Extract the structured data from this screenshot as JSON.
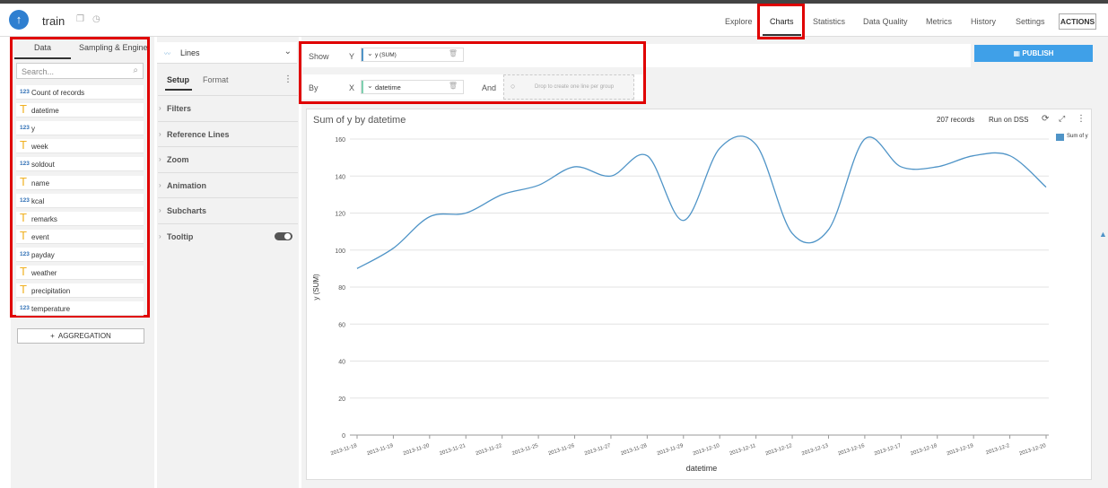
{
  "app": {
    "dataset_name": "train",
    "nav": [
      "Explore",
      "Charts",
      "Statistics",
      "Data Quality",
      "Metrics",
      "History",
      "Settings"
    ],
    "actions_label": "ACTIONS"
  },
  "left_panel": {
    "tabs": [
      "Data",
      "Sampling & Engine"
    ],
    "search_placeholder": "Search...",
    "fields": [
      {
        "type": "123",
        "name": "Count of records"
      },
      {
        "type": "T",
        "name": "datetime"
      },
      {
        "type": "123",
        "name": "y"
      },
      {
        "type": "T",
        "name": "week"
      },
      {
        "type": "123",
        "name": "soldout"
      },
      {
        "type": "T",
        "name": "name"
      },
      {
        "type": "123",
        "name": "kcal"
      },
      {
        "type": "T",
        "name": "remarks"
      },
      {
        "type": "T",
        "name": "event"
      },
      {
        "type": "123",
        "name": "payday"
      },
      {
        "type": "T",
        "name": "weather"
      },
      {
        "type": "T",
        "name": "precipitation"
      },
      {
        "type": "123",
        "name": "temperature"
      }
    ],
    "aggregation_label": "AGGREGATION"
  },
  "mid_panel": {
    "chart_type": "Lines",
    "tabs": [
      "Setup",
      "Format"
    ],
    "sections": [
      "Filters",
      "Reference Lines",
      "Zoom",
      "Animation",
      "Subcharts",
      "Tooltip"
    ]
  },
  "controls": {
    "show_label": "Show",
    "by_label": "By",
    "and_label": "And",
    "y_axis_label": "Y",
    "x_axis_label": "X",
    "y_pill": "y (SUM)",
    "x_pill": "datetime",
    "drop_text": "Drop to create one line per group",
    "publish_label": "PUBLISH"
  },
  "chart_header": {
    "title": "Sum of y by datetime",
    "records": "207 records",
    "run_on": "Run on DSS"
  },
  "colors": {
    "accent": "#2f7fd0",
    "line": "#4f94c7",
    "publish": "#3fa0e8",
    "highlight": "#e00000"
  },
  "chart_data": {
    "type": "line",
    "title": "Sum of y by datetime",
    "xlabel": "datetime",
    "ylabel": "y (SUM)",
    "ylim": [
      0,
      160
    ],
    "yticks": [
      0,
      20,
      40,
      60,
      80,
      100,
      120,
      140,
      160
    ],
    "grid": true,
    "legend": "top-right",
    "categories": [
      "2013-11-18",
      "2013-11-19",
      "2013-11-20",
      "2013-11-21",
      "2013-11-22",
      "2013-11-25",
      "2013-11-26",
      "2013-11-27",
      "2013-11-28",
      "2013-11-29",
      "2013-12-10",
      "2013-12-11",
      "2013-12-12",
      "2013-12-13",
      "2013-12-16",
      "2013-12-17",
      "2013-12-18",
      "2013-12-19",
      "2013-12-2",
      "2013-12-20"
    ],
    "series": [
      {
        "name": "Sum of y",
        "values": [
          90,
          101,
          118,
          120,
          130,
          135,
          145,
          140,
          151,
          116,
          155,
          157,
          109,
          111,
          160,
          145,
          145,
          151,
          151,
          134
        ]
      }
    ]
  }
}
